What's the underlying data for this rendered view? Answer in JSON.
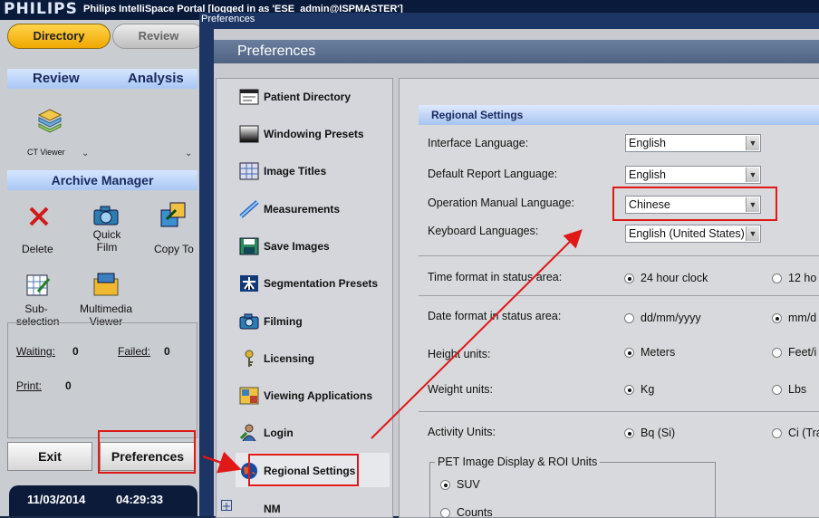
{
  "app": {
    "logo": "PHILIPS",
    "title": "Philips IntelliSpace Portal [logged in as 'ESE_admin@ISPMASTER']"
  },
  "left": {
    "tabs": [
      "Directory",
      "Review"
    ],
    "review_label": "Review",
    "analysis_label": "Analysis",
    "ct_viewer": "CT Viewer",
    "archive_manager": "Archive Manager",
    "actions": {
      "delete": "Delete",
      "quick_film": "Quick\nFilm",
      "copy_to": "Copy To",
      "subselection": "Sub-\nselection",
      "multimedia_viewer": "Multimedia\nViewer"
    },
    "queue": {
      "waiting_label": "Waiting:",
      "waiting_value": "0",
      "failed_label": "Failed:",
      "failed_value": "0",
      "print_label": "Print:",
      "print_value": "0"
    },
    "exit": "Exit",
    "preferences": "Preferences",
    "date": "11/03/2014",
    "time": "04:29:33"
  },
  "dialog": {
    "window_title": "Preferences",
    "header": "Preferences",
    "nav": [
      "Patient Directory",
      "Windowing Presets",
      "Image Titles",
      "Measurements",
      "Save Images",
      "Segmentation Presets",
      "Filming",
      "Licensing",
      "Viewing Applications",
      "Login",
      "Regional Settings",
      "NM"
    ],
    "section_title": "Regional Settings",
    "fields": {
      "interface_language": {
        "label": "Interface Language:",
        "value": "English"
      },
      "default_report_language": {
        "label": "Default Report Language:",
        "value": "English"
      },
      "operation_manual_language": {
        "label": "Operation Manual Language:",
        "value": "Chinese"
      },
      "keyboard_languages": {
        "label": "Keyboard Languages:",
        "value": "English (United States)"
      }
    },
    "options": {
      "time_format": {
        "label": "Time format in status area:",
        "opt1": "24 hour clock",
        "opt2": "12 ho"
      },
      "date_format": {
        "label": "Date format in status area:",
        "opt1": "dd/mm/yyyy",
        "opt2": "mm/d"
      },
      "height_units": {
        "label": "Height units:",
        "opt1": "Meters",
        "opt2": "Feet/i"
      },
      "weight_units": {
        "label": "Weight units:",
        "opt1": "Kg",
        "opt2": "Lbs"
      },
      "activity_units": {
        "label": "Activity Units:",
        "opt1": "Bq (Si)",
        "opt2": "Ci (Tra"
      }
    },
    "pet_group": {
      "label": "PET Image Display & ROI Units",
      "opt1": "SUV",
      "opt2": "Counts"
    }
  },
  "colors": {
    "highlight_red": "#e01818",
    "tab_active": "#f0a800",
    "section_blue": "#a8c4f0"
  }
}
